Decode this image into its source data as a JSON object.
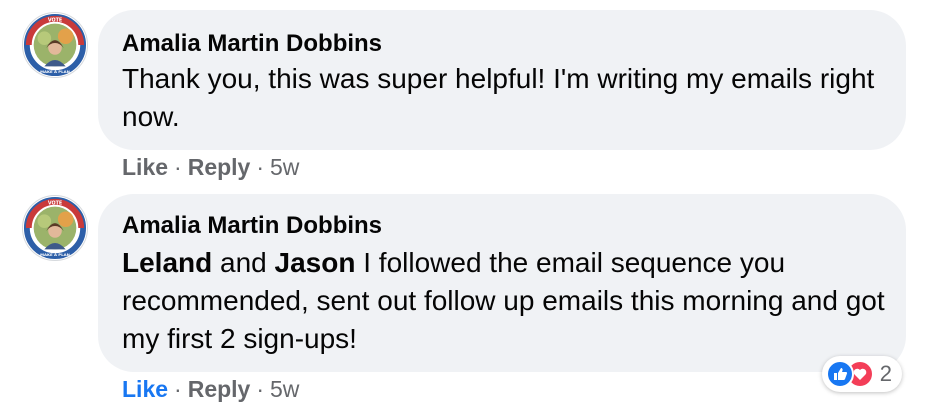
{
  "comments": [
    {
      "author": "Amalia Martin Dobbins",
      "text": "Thank you, this was super helpful! I'm writing my emails right now.",
      "actions": {
        "like": "Like",
        "separator": "·",
        "reply": "Reply",
        "time": "5w"
      }
    },
    {
      "author": "Amalia Martin Dobbins",
      "mention_1": "Leland",
      "connector": "and",
      "mention_2": "Jason",
      "text": "I followed the email sequence you recommended, sent out follow up emails this morning and got my first 2 sign-ups!",
      "actions": {
        "like": "Like",
        "separator": "·",
        "reply": "Reply",
        "time": "5w"
      },
      "reactions": {
        "icons": [
          "like-icon",
          "love-icon"
        ],
        "count": "2"
      }
    }
  ],
  "avatar_badge": {
    "top_text": "VOTE",
    "bottom_text": "MAKE A PLAN"
  },
  "colors": {
    "bubble": "#f0f2f5",
    "link_blue": "#1877f2",
    "muted": "#65676b",
    "love_red": "#f33e58"
  }
}
